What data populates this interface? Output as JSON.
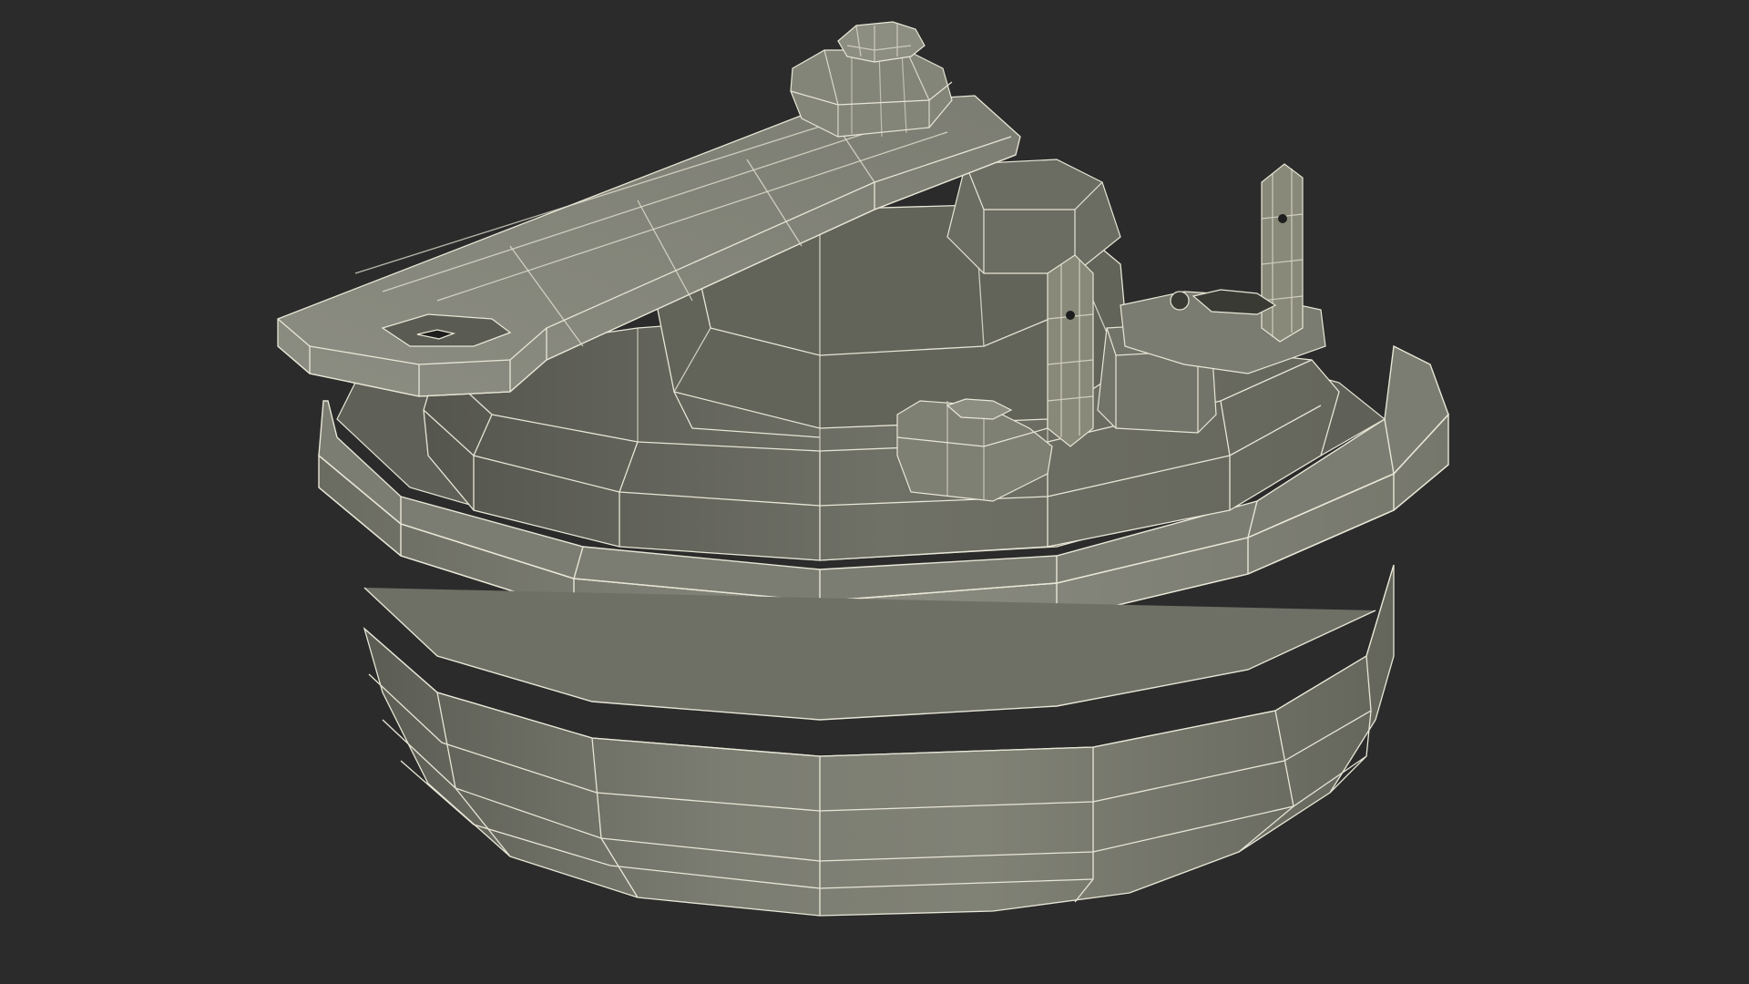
{
  "scene": {
    "subject": "wireframe-render",
    "colors": {
      "background": "#2b2b2b",
      "surface_light": "#8a8b80",
      "surface_mid": "#7a7b70",
      "surface_dark": "#5d5e55",
      "surface_shadow": "#45463f",
      "wire": "#e8e6d6"
    }
  }
}
